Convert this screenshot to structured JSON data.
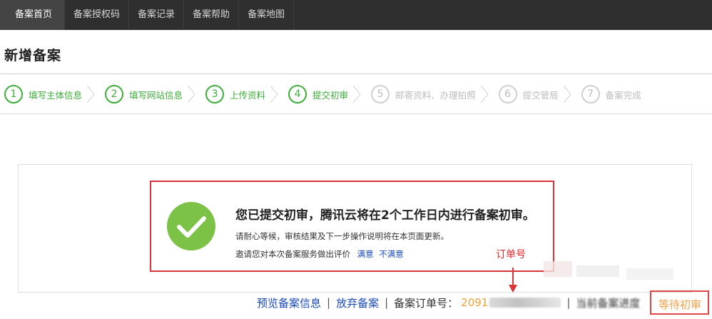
{
  "nav": {
    "items": [
      {
        "label": "备案首页",
        "active": true
      },
      {
        "label": "备案授权码",
        "active": false
      },
      {
        "label": "备案记录",
        "active": false
      },
      {
        "label": "备案帮助",
        "active": false
      },
      {
        "label": "备案地图",
        "active": false
      }
    ]
  },
  "page": {
    "title": "新增备案"
  },
  "steps": [
    {
      "num": "1",
      "label": "填写主体信息",
      "state": "done"
    },
    {
      "num": "2",
      "label": "填写网站信息",
      "state": "done"
    },
    {
      "num": "3",
      "label": "上传资料",
      "state": "done"
    },
    {
      "num": "4",
      "label": "提交初审",
      "state": "current"
    },
    {
      "num": "5",
      "label": "邮寄资料、办理拍照",
      "state": "pending"
    },
    {
      "num": "6",
      "label": "提交管局",
      "state": "pending"
    },
    {
      "num": "7",
      "label": "备案完成",
      "state": "pending"
    }
  ],
  "notice": {
    "title": "您已提交初审，腾讯云将在2个工作日内进行备案初审。",
    "desc": "请耐心等候，审核结果及下一步操作说明将在本页面更新。",
    "eval_prompt": "邀请您对本次备案服务做出评价",
    "satisfied": "满意",
    "unsatisfied": "不满意"
  },
  "annotation": {
    "order_label": "订单号"
  },
  "info": {
    "preview_link": "预览备案信息",
    "abandon_link": "放弃备案",
    "separator": "|",
    "order_label": "备案订单号：",
    "order_no_visible": "2091",
    "progress_label": "当前备案进度",
    "status": "等待初审"
  },
  "colors": {
    "nav_bg": "#2f2f2f",
    "step_done": "#3ead3a",
    "step_pending": "#bdbdbd",
    "highlight_red": "#d9353a",
    "link_blue": "#1a4ab8",
    "order_orange": "#f0a23b"
  },
  "icons": {
    "success": "check-circle-icon",
    "step_separator": "chevron-right-icon",
    "annotation_arrow": "arrow-down-icon"
  }
}
